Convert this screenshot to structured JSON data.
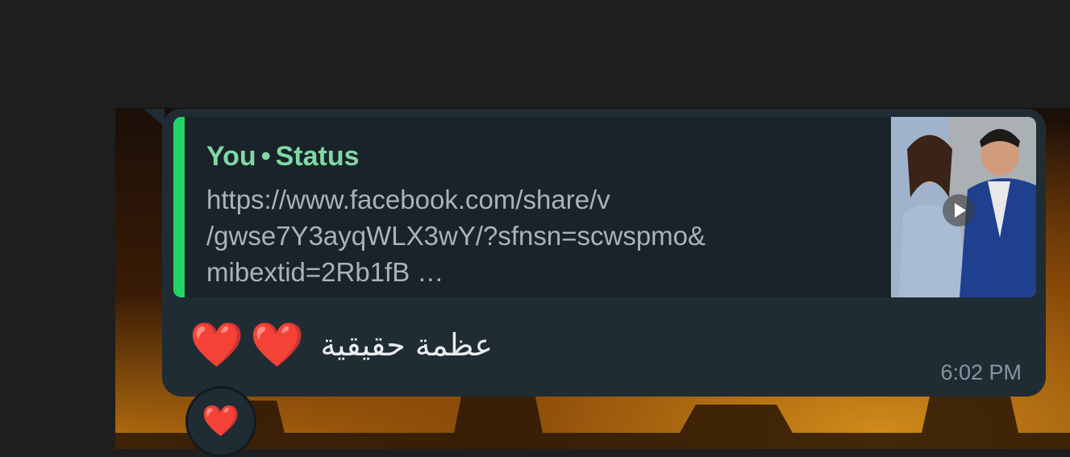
{
  "reply": {
    "sender": "You",
    "separator": "•",
    "context": "Status",
    "url_text": "https://www.facebook.com/share/v\n/gwse7Y3ayqWLX3wY/?sfnsn=scwspmo&\nmibextid=2Rb1fB …",
    "thumbnail_icon": "play-icon"
  },
  "message": {
    "text": "عظمة حقيقية",
    "emoji_1": "❤️",
    "emoji_2": "❤️",
    "time": "6:02 PM"
  },
  "reaction": {
    "emoji": "❤️"
  },
  "colors": {
    "bubble": "#202c33",
    "quote_bar": "#25d366",
    "quote_title": "#7fd9a5"
  }
}
